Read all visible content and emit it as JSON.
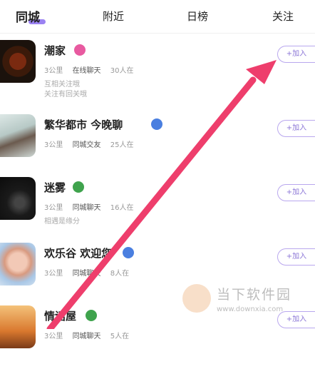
{
  "tabs": [
    {
      "label": "同城",
      "active": true
    },
    {
      "label": "附近",
      "active": false
    },
    {
      "label": "日榜",
      "active": false
    },
    {
      "label": "关注",
      "active": false
    }
  ],
  "colors": {
    "accent": "#8a6cf0",
    "join_border": "#b9a7ee",
    "arrow": "#ee3e6c"
  },
  "join_label": "+加入",
  "groups": [
    {
      "name": "潮家",
      "badge_color": "#e85aa0",
      "meta": "3公里",
      "tag": "在线聊天",
      "members": "30人在",
      "desc": "互相关注哦\n关注有回关哦"
    },
    {
      "name": "繁华都市 今晚聊",
      "badge_color": "#4a7fe0",
      "meta": "3公里",
      "tag": "同城交友",
      "members": "25人在",
      "desc": ""
    },
    {
      "name": "迷雾",
      "badge_color": "#3fa34d",
      "meta": "3公里",
      "tag": "同城聊天",
      "members": "16人在",
      "desc": "相遇是缘分"
    },
    {
      "name": "欢乐谷 欢迎您",
      "badge_color": "#4a7fe0",
      "meta": "3公里",
      "tag": "同城聊天",
      "members": "8人在",
      "desc": ""
    },
    {
      "name": "情话屋",
      "badge_color": "#3fa34d",
      "meta": "3公里",
      "tag": "同城聊天",
      "members": "5人在",
      "desc": ""
    }
  ],
  "watermark": {
    "cn": "当下软件园",
    "url": "www.downxia.com",
    "icon": "downxia-logo-icon"
  }
}
